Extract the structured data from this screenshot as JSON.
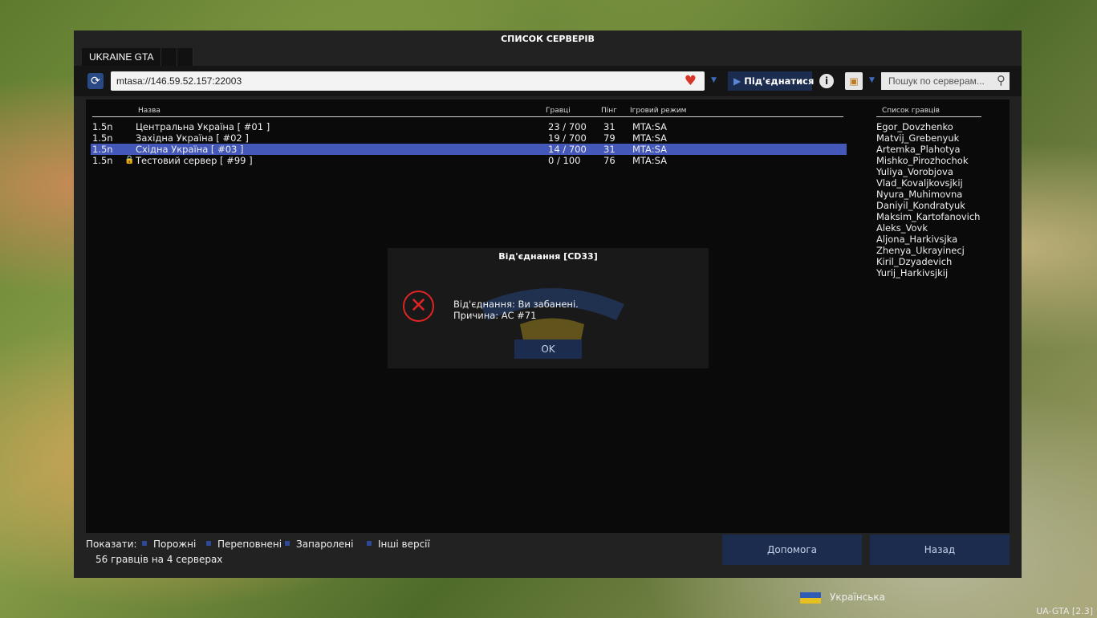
{
  "window": {
    "title": "СПИСОК СЕРВЕРІВ"
  },
  "tabs": [
    "UKRAINE GTA",
    "",
    ""
  ],
  "toolbar": {
    "address": "mtasa://146.59.52.157:22003",
    "connect_label": "Під'єднатися",
    "search_placeholder": "Пошук по серверам..."
  },
  "table": {
    "headers": {
      "name": "Назва",
      "players": "Гравці",
      "ping": "Пінг",
      "gamemode": "Ігровий режим"
    },
    "rows": [
      {
        "version": "1.5n",
        "locked": false,
        "name": "Центральна Україна [ #01 ]",
        "players": "23 / 700",
        "ping": "31",
        "gamemode": "MTA:SA",
        "selected": false
      },
      {
        "version": "1.5n",
        "locked": false,
        "name": "Західна Україна [ #02 ]",
        "players": "19 / 700",
        "ping": "79",
        "gamemode": "MTA:SA",
        "selected": false
      },
      {
        "version": "1.5n",
        "locked": false,
        "name": "Східна Україна [ #03 ]",
        "players": "14 / 700",
        "ping": "31",
        "gamemode": "MTA:SA",
        "selected": true
      },
      {
        "version": "1.5n",
        "locked": true,
        "name": "Тестовий сервер [ #99 ]",
        "players": "0 / 100",
        "ping": "76",
        "gamemode": "MTA:SA",
        "selected": false
      }
    ]
  },
  "players": {
    "header": "Список гравців",
    "list": [
      "Egor_Dovzhenko",
      "Matvij_Grebenyuk",
      "Artemka_Plahotya",
      "Mishko_Pirozhochok",
      "Yuliya_Vorobjova",
      "Vlad_Kovaljkovsjkij",
      "Nyura_Muhimovna",
      "Daniyil_Kondratyuk",
      "Maksim_Kartofanovich",
      "Aleks_Vovk",
      "Aljona_Harkivsjka",
      "Zhenya_Ukrayinecj",
      "Kiril_Dzyadevich",
      "Yurij_Harkivsjkij"
    ]
  },
  "footer": {
    "show_label": "Показати:",
    "filters": [
      "Порожні",
      "Переповнені",
      "Запаролені",
      "Інші версії"
    ],
    "status": "56 гравців на 4 серверах",
    "help_label": "Допомога",
    "back_label": "Назад"
  },
  "dialog": {
    "title": "Від'єднання [CD33]",
    "line1": "Від'єднання: Ви забанені.",
    "line2": "Причина: AC #71",
    "ok_label": "OK"
  },
  "language": {
    "label": "Українська"
  },
  "version": "UA-GTA [2.3]",
  "colors": {
    "accent": "#1b2c4e",
    "selection": "#4358b8",
    "error": "#e02424"
  }
}
